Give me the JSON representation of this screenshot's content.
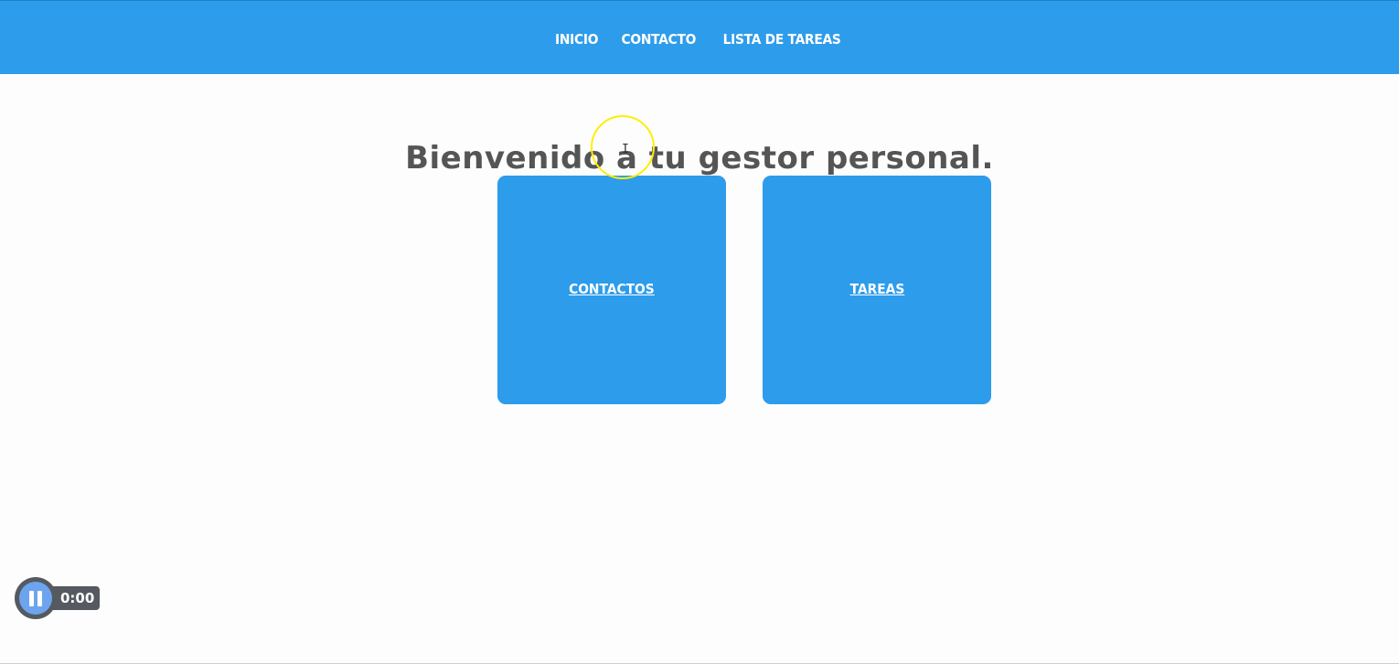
{
  "nav": {
    "items": [
      {
        "label": "INICIO"
      },
      {
        "label": "CONTACTO"
      },
      {
        "label": "LISTA DE TAREAS"
      }
    ]
  },
  "main": {
    "title": "Bienvenido a tu gestor personal.",
    "cards": [
      {
        "label": "CONTACTOS"
      },
      {
        "label": "TAREAS"
      }
    ]
  },
  "player": {
    "time": "0:00",
    "icon": "pause-icon"
  },
  "colors": {
    "accent": "#2d9ceb",
    "title_text": "#555555",
    "background": "#fdfdfe",
    "cursor_highlight": "#ffee00"
  }
}
